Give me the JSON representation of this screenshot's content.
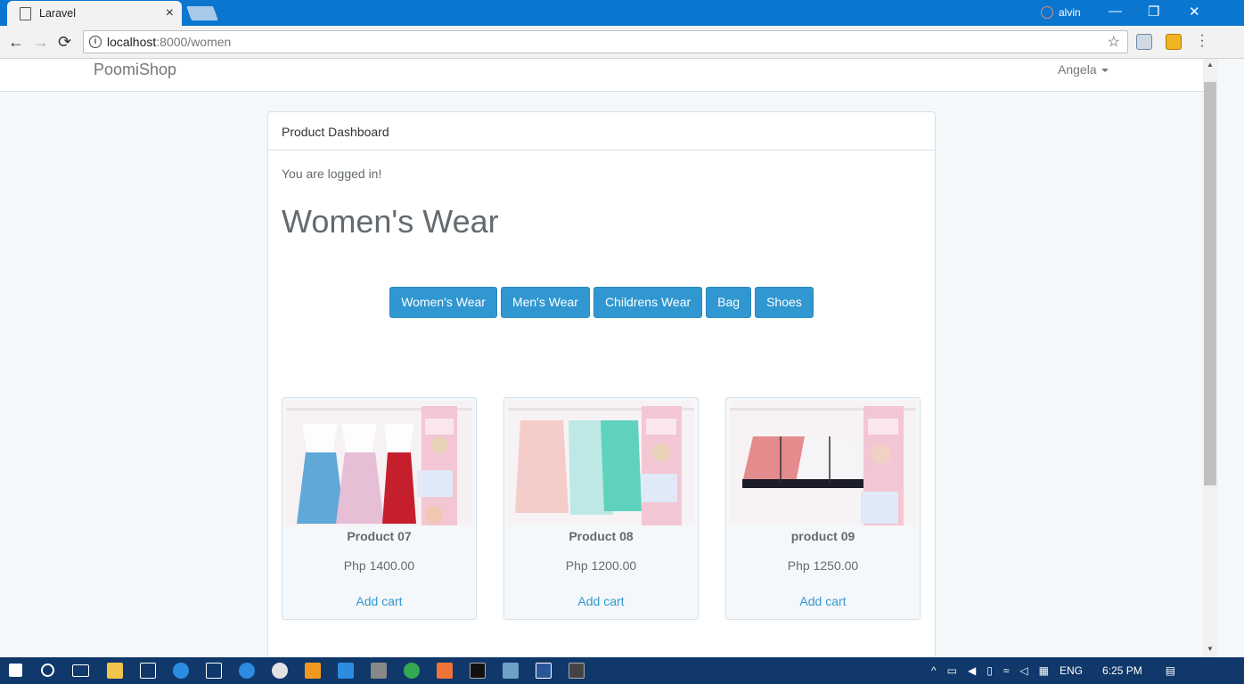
{
  "browser": {
    "tab_title": "Laravel",
    "tab_close": "×",
    "user_name": "alvin",
    "address_host": "localhost",
    "address_path": ":8000/women",
    "star": "☆",
    "back": "←",
    "forward": "→",
    "reload": "⟳",
    "minimize": "—",
    "restore": "❐",
    "close": "✕"
  },
  "navbar": {
    "brand": "PoomiShop",
    "user": "Angela"
  },
  "panel": {
    "heading": "Product Dashboard",
    "status": "You are logged in!",
    "title": "Women's Wear"
  },
  "categories": [
    {
      "label": "Women's Wear"
    },
    {
      "label": "Men's Wear"
    },
    {
      "label": "Childrens Wear"
    },
    {
      "label": "Bag"
    },
    {
      "label": "Shoes"
    }
  ],
  "products": [
    {
      "name": "Product 07",
      "price": "Php 1400.00",
      "action": "Add cart",
      "image": "clothes-tops-dresses"
    },
    {
      "name": "Product 08",
      "price": "Php 1200.00",
      "action": "Add cart",
      "image": "clothes-shirts"
    },
    {
      "name": "product 09",
      "price": "Php 1250.00",
      "action": "Add cart",
      "image": "clothes-jackets"
    }
  ],
  "taskbar": {
    "lang": "ENG",
    "time": "6:25 PM"
  },
  "colors": {
    "primary": "#3097d1",
    "titlebar": "#0a76d0",
    "taskbar": "#10386a",
    "page_bg": "#f5f8fa"
  }
}
